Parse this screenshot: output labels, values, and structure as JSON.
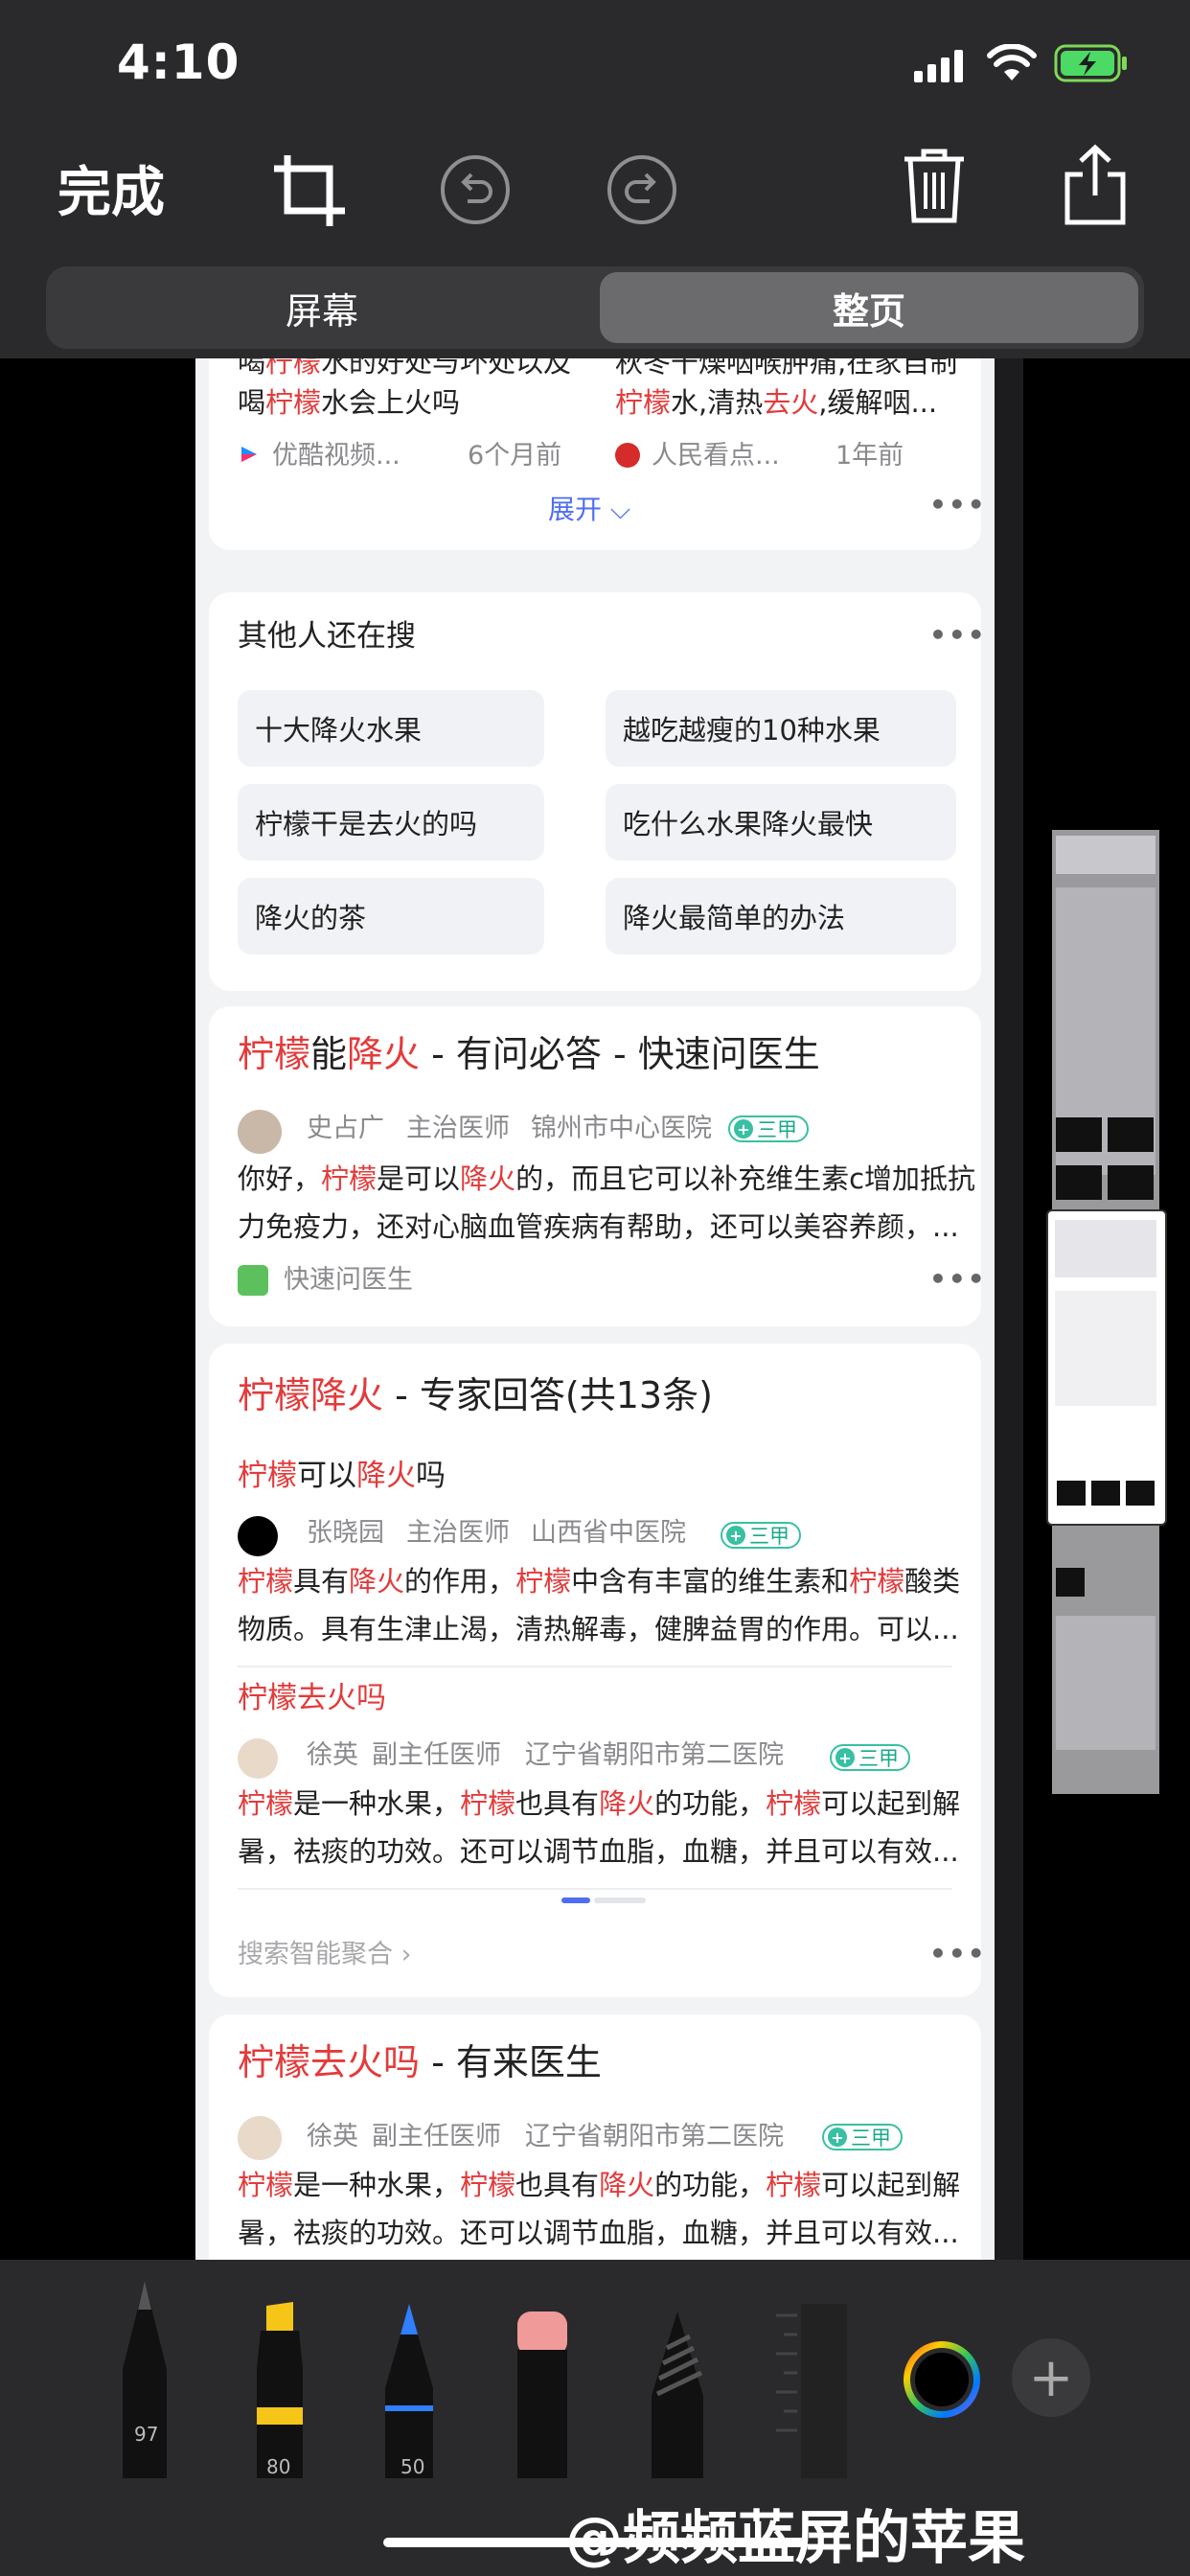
{
  "status_bar": {
    "time": "4:10"
  },
  "toolbar": {
    "done_label": "完成",
    "icons": [
      "crop-icon",
      "undo-icon",
      "redo-icon",
      "trash-icon",
      "share-icon"
    ]
  },
  "segment": {
    "screen_label": "屏幕",
    "full_page_label": "整页"
  },
  "card1": {
    "left_line1_a": "喝",
    "left_line1_b": "柠檬",
    "left_line1_c": "水的好处与坏处以及",
    "left_line2_a": "喝",
    "left_line2_b": "柠檬",
    "left_line2_c": "水会上火吗",
    "left_source": "优酷视频...",
    "left_time": "6个月前",
    "right_line1": "秋冬干燥咽喉肿痛,在家自制",
    "right_line2_a": "柠檬",
    "right_line2_b": "水,清热",
    "right_line2_c": "去火",
    "right_line2_d": ",缓解咽...",
    "right_source": "人民看点...",
    "right_time": "1年前",
    "expand_label": "展开"
  },
  "related": {
    "title": "其他人还在搜",
    "chips": [
      "十大降火水果",
      "越吃越瘦的10种水果",
      "柠檬干是去火的吗",
      "吃什么水果降火最快",
      "降火的茶",
      "降火最简单的办法"
    ]
  },
  "result1": {
    "title_a": "柠檬",
    "title_b": "能",
    "title_c": "降火",
    "title_d": " - 有问必答 - 快速问医生",
    "doctor": "史占广",
    "role": "主治医师",
    "hospital": "锦州市中心医院",
    "badge": "三甲",
    "line1_a": "你好，",
    "line1_b": "柠檬",
    "line1_c": "是可以",
    "line1_d": "降火",
    "line1_e": "的，而且它可以补充维生素c增加抵抗",
    "line2": "力免疫力，还对心脑血管疾病有帮助，还可以美容养颜，...",
    "source": "快速问医生"
  },
  "result2": {
    "title_a": "柠檬降火",
    "title_b": " - 专家回答(共13条)",
    "q1_a": "柠檬",
    "q1_b": "可以",
    "q1_c": "降火",
    "q1_d": "吗",
    "q1_doctor": "张晓园",
    "q1_role": "主治医师",
    "q1_hospital": "山西省中医院",
    "q1_badge": "三甲",
    "q1_line1_a": "柠檬",
    "q1_line1_b": "具有",
    "q1_line1_c": "降火",
    "q1_line1_d": "的作用，",
    "q1_line1_e": "柠檬",
    "q1_line1_f": "中含有丰富的维生素和",
    "q1_line1_g": "柠檬",
    "q1_line1_h": "酸类",
    "q1_line2": "物质。具有生津止渴，清热解毒，健脾益胃的作用。可以...",
    "q2_title": "柠檬去火吗",
    "q2_doctor": "徐英",
    "q2_role": "副主任医师",
    "q2_hospital": "辽宁省朝阳市第二医院",
    "q2_badge": "三甲",
    "q2_line1_a": "柠檬",
    "q2_line1_b": "是一种水果，",
    "q2_line1_c": "柠檬",
    "q2_line1_d": "也具有",
    "q2_line1_e": "降火",
    "q2_line1_f": "的功能，",
    "q2_line1_g": "柠檬",
    "q2_line1_h": "可以起到解",
    "q2_line2": "暑，祛痰的功效。还可以调节血脂，血糖，并且可以有效...",
    "footer": "搜索智能聚合 ›"
  },
  "result3": {
    "title_a": "柠檬去火吗",
    "title_b": " - 有来医生",
    "doctor": "徐英",
    "role": "副主任医师",
    "hospital": "辽宁省朝阳市第二医院",
    "badge": "三甲",
    "line1_a": "柠檬",
    "line1_b": "是一种水果，",
    "line1_c": "柠檬",
    "line1_d": "也具有",
    "line1_e": "降火",
    "line1_f": "的功能，",
    "line1_g": "柠檬",
    "line1_h": "可以起到解",
    "line2": "暑，祛痰的功效。还可以调节血脂，血糖，并且可以有效..."
  },
  "tools": {
    "pen_width": "97",
    "marker_width": "80",
    "pencil_width": "50"
  },
  "watermark": "@频频蓝屏的苹果",
  "colors": {
    "accent_red": "#e33b3b",
    "link_blue": "#4e6ef2",
    "badge_green": "#39c0a3"
  }
}
